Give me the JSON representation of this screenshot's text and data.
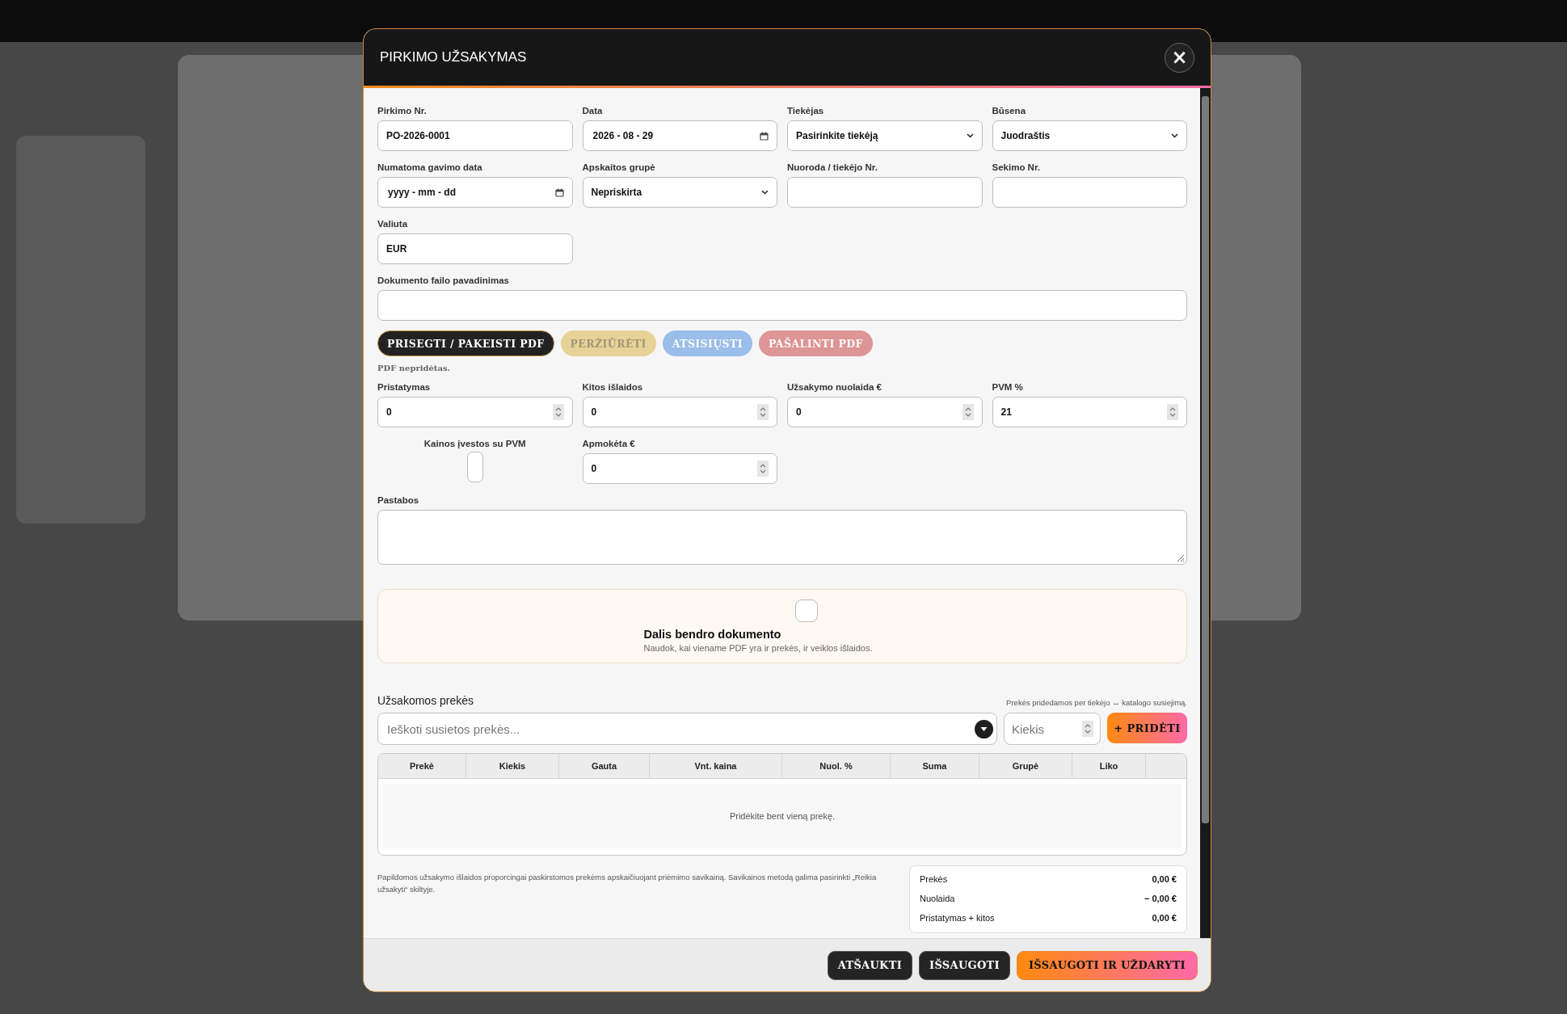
{
  "window": {
    "title": "PIRKIMO UŽSAKYMAS",
    "close": "×"
  },
  "top_fields": [
    {
      "label": "Pirkimo Nr.",
      "kind": "text",
      "value": "PO-2026-0001"
    },
    {
      "label": "Data",
      "kind": "date",
      "value": "2026 - 08 - 29"
    },
    {
      "label": "Tiekėjas",
      "kind": "select",
      "value": "Pasirinkite tiekėją"
    },
    {
      "label": "Būsena",
      "kind": "select",
      "value": "Juodraštis"
    },
    {
      "label": "Numatoma gavimo data",
      "kind": "date",
      "placeholder": "yyyy - mm - dd"
    },
    {
      "label": "Apskaitos grupė",
      "kind": "select",
      "value": "Nepriskirta"
    },
    {
      "label": "Nuoroda / tiekėjo Nr.",
      "kind": "text"
    },
    {
      "label": "Sekimo Nr.",
      "kind": "text"
    },
    {
      "label": "Valiuta",
      "kind": "text",
      "value": "EUR"
    }
  ],
  "file_name": {
    "label": "Dokumento failo pavadinimas"
  },
  "pdf_buttons": [
    {
      "label": "PRISEGTI / PAKEISTI PDF",
      "kind": "dark",
      "disabled": false
    },
    {
      "label": "PERŽIŪRĖTI",
      "kind": "gold",
      "disabled": true
    },
    {
      "label": "ATSISIŲSTI",
      "kind": "blue",
      "disabled": true
    },
    {
      "label": "PAŠALINTI PDF",
      "kind": "red",
      "disabled": true
    }
  ],
  "pdf_status": "PDF nepridėtas.",
  "cost_fields": [
    {
      "label": "Pristatymas",
      "kind": "number",
      "value": "0"
    },
    {
      "label": "Kitos išlaidos",
      "kind": "number",
      "value": "0"
    },
    {
      "label": "Užsakymo nuolaida €",
      "kind": "number",
      "value": "0"
    },
    {
      "label": "PVM %",
      "kind": "number",
      "value": "21"
    }
  ],
  "prices_with_vat": {
    "label": "Kainos įvestos su PVM",
    "checked": false
  },
  "paid": {
    "label": "Apmokėta €",
    "kind": "number",
    "value": "0"
  },
  "notes": {
    "label": "Pastabos"
  },
  "shared_document": {
    "checked": false,
    "title": "Dalis bendro dokumento",
    "hint": "Naudok, kai viename PDF yra ir prekės, ir veiklos išlaidos."
  },
  "items": {
    "title": "Užsakomos prekės",
    "hint": "Prekės pridedamos per tiekėjo ↔ katalogo susiejimą.",
    "search_placeholder": "Ieškoti susietos prekės...",
    "quantity_placeholder": "Kiekis",
    "add_button": "+ PRIDĖTI",
    "columns": [
      "Prekė",
      "Kiekis",
      "Gauta",
      "Vnt. kaina",
      "Nuol. %",
      "Suma",
      "Grupė",
      "Liko"
    ],
    "empty_text": "Pridėkite bent vieną prekę."
  },
  "cost_note": "Papildomos užsakymo išlaidos proporcingai paskirstomos prekėms apskaičiuojant priėmimo savikainą. Savikainos metodą galima pasirinkti „Reikia užsakyti“ skiltyje.",
  "summary": [
    {
      "label": "Prekės",
      "value": "0,00 €"
    },
    {
      "label": "Nuolaida",
      "value": "− 0,00 €"
    },
    {
      "label": "Pristatymas + kitos",
      "value": "0,00 €"
    }
  ],
  "footer_buttons": [
    {
      "label": "ATŠAUKTI",
      "kind": "dark"
    },
    {
      "label": "IŠSAUGOTI",
      "kind": "dark"
    },
    {
      "label": "IŠSAUGOTI IR UŽDARYTI",
      "kind": "primary"
    }
  ]
}
